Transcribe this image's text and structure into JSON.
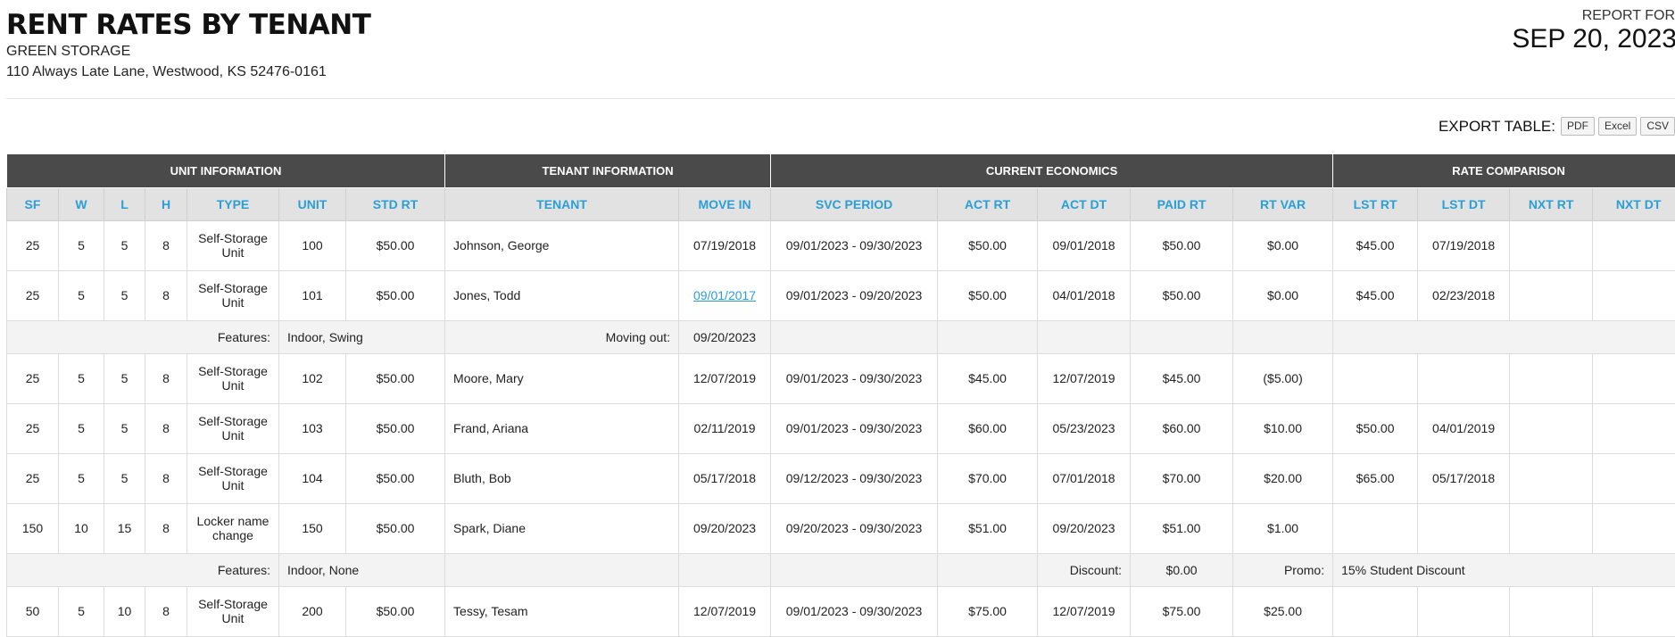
{
  "header": {
    "title": "RENT RATES BY TENANT",
    "company": "GREEN STORAGE",
    "address": "110 Always Late Lane, Westwood, KS 52476-0161",
    "report_for_label": "REPORT FOR",
    "report_date": "SEP 20, 2023"
  },
  "export": {
    "label": "EXPORT TABLE:",
    "buttons": [
      "PDF",
      "Excel",
      "CSV"
    ]
  },
  "table": {
    "groups": [
      "UNIT INFORMATION",
      "TENANT INFORMATION",
      "CURRENT ECONOMICS",
      "RATE COMPARISON"
    ],
    "columns": [
      "SF",
      "W",
      "L",
      "H",
      "TYPE",
      "UNIT",
      "STD RT",
      "TENANT",
      "MOVE IN",
      "SVC PERIOD",
      "ACT RT",
      "ACT DT",
      "PAID RT",
      "RT VAR",
      "LST RT",
      "LST DT",
      "NXT RT",
      "NXT DT"
    ],
    "rows": [
      {
        "sf": "25",
        "w": "5",
        "l": "5",
        "h": "8",
        "type": "Self-Storage Unit",
        "unit": "100",
        "std_rt": "$50.00",
        "tenant": "Johnson, George",
        "move_in": "07/19/2018",
        "svc_period": "09/01/2023 - 09/30/2023",
        "act_rt": "$50.00",
        "act_dt": "09/01/2018",
        "paid_rt": "$50.00",
        "rt_var": "$0.00",
        "lst_rt": "$45.00",
        "lst_dt": "07/19/2018",
        "nxt_rt": "",
        "nxt_dt": ""
      },
      {
        "sf": "25",
        "w": "5",
        "l": "5",
        "h": "8",
        "type": "Self-Storage Unit",
        "unit": "101",
        "std_rt": "$50.00",
        "tenant": "Jones, Todd",
        "move_in": "09/01/2017",
        "svc_period": "09/01/2023 - 09/20/2023",
        "act_rt": "$50.00",
        "act_dt": "04/01/2018",
        "paid_rt": "$50.00",
        "rt_var": "$0.00",
        "lst_rt": "$45.00",
        "lst_dt": "02/23/2018",
        "nxt_rt": "",
        "nxt_dt": ""
      },
      {
        "sf": "25",
        "w": "5",
        "l": "5",
        "h": "8",
        "type": "Self-Storage Unit",
        "unit": "102",
        "std_rt": "$50.00",
        "tenant": "Moore, Mary",
        "move_in": "12/07/2019",
        "svc_period": "09/01/2023 - 09/30/2023",
        "act_rt": "$45.00",
        "act_dt": "12/07/2019",
        "paid_rt": "$45.00",
        "rt_var": "($5.00)",
        "lst_rt": "",
        "lst_dt": "",
        "nxt_rt": "",
        "nxt_dt": ""
      },
      {
        "sf": "25",
        "w": "5",
        "l": "5",
        "h": "8",
        "type": "Self-Storage Unit",
        "unit": "103",
        "std_rt": "$50.00",
        "tenant": "Frand, Ariana",
        "move_in": "02/11/2019",
        "svc_period": "09/01/2023 - 09/30/2023",
        "act_rt": "$60.00",
        "act_dt": "05/23/2023",
        "paid_rt": "$60.00",
        "rt_var": "$10.00",
        "lst_rt": "$50.00",
        "lst_dt": "04/01/2019",
        "nxt_rt": "",
        "nxt_dt": ""
      },
      {
        "sf": "25",
        "w": "5",
        "l": "5",
        "h": "8",
        "type": "Self-Storage Unit",
        "unit": "104",
        "std_rt": "$50.00",
        "tenant": "Bluth, Bob",
        "move_in": "05/17/2018",
        "svc_period": "09/12/2023 - 09/30/2023",
        "act_rt": "$70.00",
        "act_dt": "07/01/2018",
        "paid_rt": "$70.00",
        "rt_var": "$20.00",
        "lst_rt": "$65.00",
        "lst_dt": "05/17/2018",
        "nxt_rt": "",
        "nxt_dt": ""
      },
      {
        "sf": "150",
        "w": "10",
        "l": "15",
        "h": "8",
        "type": "Locker name change",
        "unit": "150",
        "std_rt": "$50.00",
        "tenant": "Spark, Diane",
        "move_in": "09/20/2023",
        "svc_period": "09/20/2023 - 09/30/2023",
        "act_rt": "$51.00",
        "act_dt": "09/20/2023",
        "paid_rt": "$51.00",
        "rt_var": "$1.00",
        "lst_rt": "",
        "lst_dt": "",
        "nxt_rt": "",
        "nxt_dt": ""
      },
      {
        "sf": "50",
        "w": "5",
        "l": "10",
        "h": "8",
        "type": "Self-Storage Unit",
        "unit": "200",
        "std_rt": "$50.00",
        "tenant": "Tessy, Tesam",
        "move_in": "12/07/2019",
        "svc_period": "09/01/2023 - 09/30/2023",
        "act_rt": "$75.00",
        "act_dt": "12/07/2019",
        "paid_rt": "$75.00",
        "rt_var": "$25.00",
        "lst_rt": "",
        "lst_dt": "",
        "nxt_rt": "",
        "nxt_dt": ""
      }
    ],
    "sub1": {
      "features_label": "Features:",
      "features": "Indoor, Swing",
      "moving_out_label": "Moving out:",
      "moving_out": "09/20/2023"
    },
    "sub2": {
      "features_label": "Features:",
      "features": "Indoor, None",
      "discount_label": "Discount:",
      "discount": "$0.00",
      "promo_label": "Promo:",
      "promo": "15% Student Discount"
    }
  },
  "colors": {
    "accent": "#2a9fd6",
    "group_header": "#4a4a4a",
    "col_header": "#e2e2e2"
  }
}
